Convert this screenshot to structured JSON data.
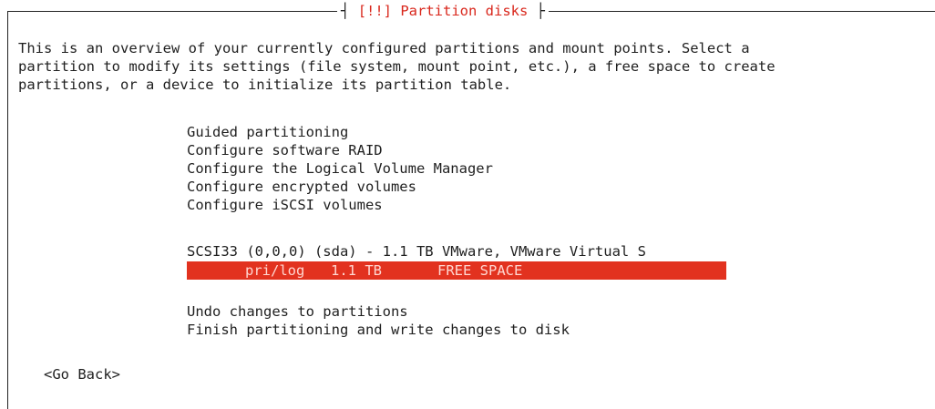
{
  "dialog": {
    "title": "[!!] Partition disks",
    "intro_lines": [
      "This is an overview of your currently configured partitions and mount points. Select a",
      "partition to modify its settings (file system, mount point, etc.), a free space to create",
      "partitions, or a device to initialize its partition table."
    ]
  },
  "menu": {
    "actions": [
      "Guided partitioning",
      "Configure software RAID",
      "Configure the Logical Volume Manager",
      "Configure encrypted volumes",
      "Configure iSCSI volumes"
    ],
    "disk": "SCSI33 (0,0,0) (sda) - 1.1 TB VMware, VMware Virtual S",
    "selected_partition": {
      "type": "pri/log",
      "size": "1.1 TB",
      "label": "FREE SPACE"
    },
    "final_actions": [
      "Undo changes to partitions",
      "Finish partitioning and write changes to disk"
    ]
  },
  "footer": {
    "go_back_label": "<Go Back>"
  },
  "colors": {
    "accent_red": "#e2321f",
    "title_red": "#d9271c"
  }
}
